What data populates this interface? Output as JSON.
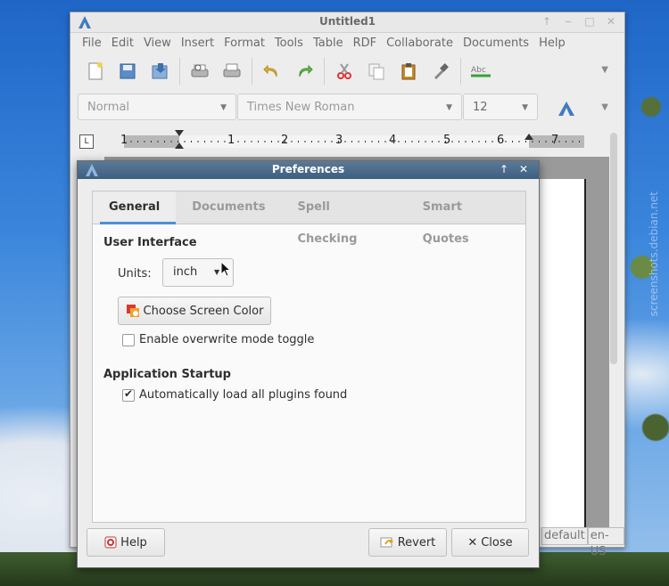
{
  "app": {
    "title": "Untitled1",
    "menu": [
      "File",
      "Edit",
      "View",
      "Insert",
      "Format",
      "Tools",
      "Table",
      "RDF",
      "Collaborate",
      "Documents",
      "Help"
    ],
    "format": {
      "style": "Normal",
      "font": "Times New Roman",
      "size": "12"
    },
    "ruler_numbers": [
      "1",
      "1",
      "2",
      "3",
      "4",
      "5",
      "6",
      "7"
    ],
    "status": {
      "style": "default",
      "lang": "en-US"
    }
  },
  "watermark": "screenshots.debian.net",
  "dialog": {
    "title": "Preferences",
    "tabs": [
      "General",
      "Documents",
      "Spell Checking",
      "Smart Quotes"
    ],
    "active_tab": "General",
    "ui_section": "User Interface",
    "units_label": "Units:",
    "units_value": "inch",
    "screen_color_button": "Choose Screen Color",
    "overwrite_label": "Enable overwrite mode toggle",
    "overwrite_checked": false,
    "startup_section": "Application Startup",
    "autoload_label": "Automatically load all plugins found",
    "autoload_checked": true,
    "help_button": "Help",
    "revert_button": "Revert",
    "close_button": "Close"
  },
  "colors": {
    "accent": "#4a90d9",
    "dialog_title": "#3d5f80"
  }
}
